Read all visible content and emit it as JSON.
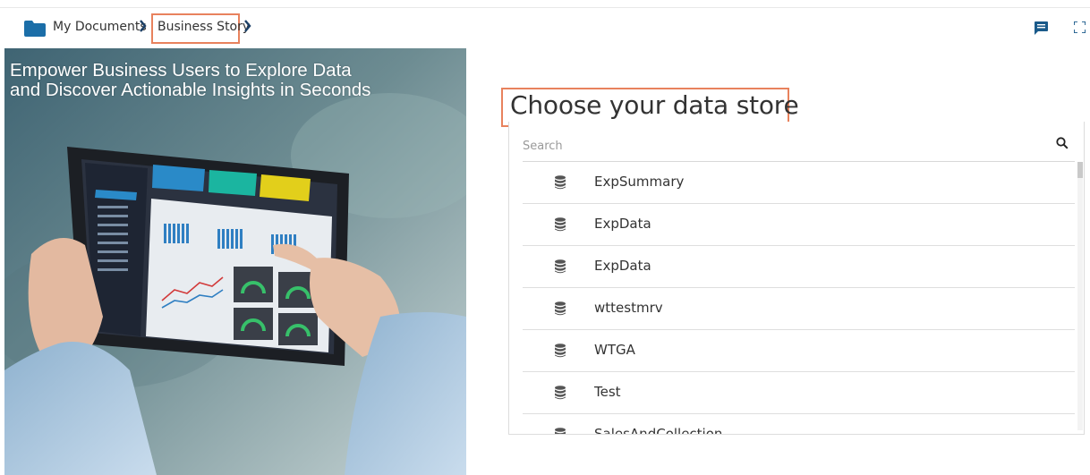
{
  "breadcrumb": {
    "root_label": "My Documents",
    "current_label": "Business Story"
  },
  "hero": {
    "title_line1": "Empower Business Users to Explore Data",
    "title_line2": "and Discover Actionable Insights in Seconds"
  },
  "datastore": {
    "title": "Choose your data store",
    "search_placeholder": "Search",
    "items": [
      {
        "label": "ExpSummary"
      },
      {
        "label": "ExpData"
      },
      {
        "label": "ExpData"
      },
      {
        "label": "wttestmrv"
      },
      {
        "label": "WTGA"
      },
      {
        "label": "Test"
      },
      {
        "label": "SalesAndCollection"
      }
    ]
  },
  "colors": {
    "accent_folder": "#1b6ea8",
    "highlight_border": "#e8825d",
    "icon_dark": "#1a5a8a"
  },
  "icons": {
    "folder": "folder-icon",
    "chevron": "chevron-right-icon",
    "comment": "comment-icon",
    "expand": "expand-icon",
    "search": "search-icon",
    "database": "database-icon"
  }
}
